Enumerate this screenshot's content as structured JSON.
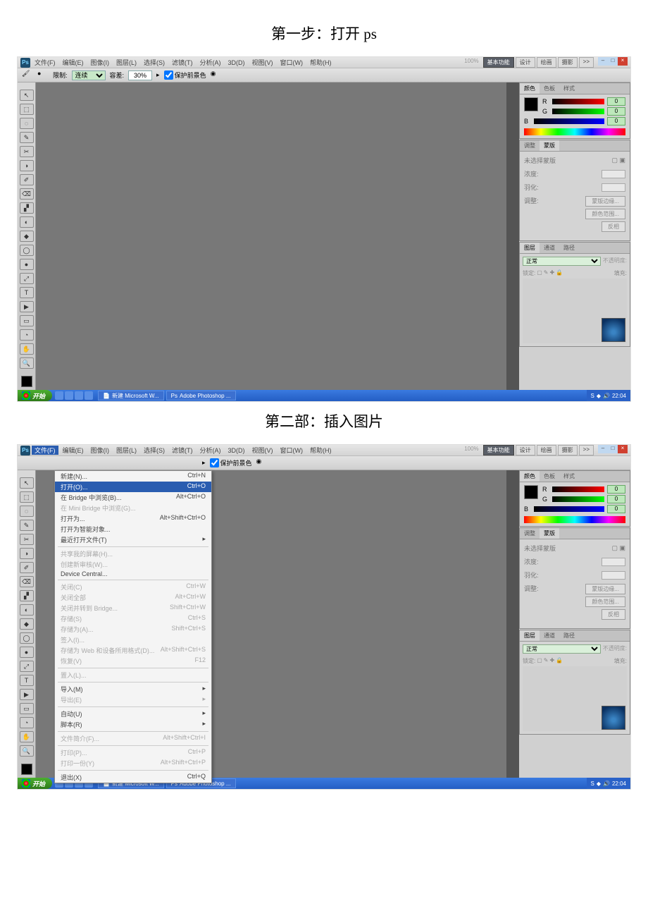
{
  "headings": {
    "step1": "第一步：打开 ps",
    "step2": "第二部：插入图片"
  },
  "menus": [
    "文件(F)",
    "编辑(E)",
    "图像(I)",
    "图层(L)",
    "选择(S)",
    "滤镜(T)",
    "分析(A)",
    "3D(D)",
    "视图(V)",
    "窗口(W)",
    "帮助(H)"
  ],
  "workspaces": {
    "active": "基本功能",
    "others": [
      "设计",
      "绘画",
      "摄影"
    ],
    "expand": ">>"
  },
  "options": {
    "limit_label": "限制:",
    "limit_value": "连续",
    "tolerance_label": "容差:",
    "tolerance_value": "30%",
    "protect": "保护前景色"
  },
  "panels": {
    "color": {
      "tabs": [
        "颜色",
        "色板",
        "样式"
      ],
      "r": "R",
      "g": "G",
      "b": "B",
      "rv": "0",
      "gv": "0",
      "bv": "0"
    },
    "mask": {
      "tabs": [
        "调整",
        "蒙版"
      ],
      "none": "未选择蒙版",
      "density": "浓度:",
      "feather": "羽化:",
      "refine": "调整:",
      "btn_edge": "蒙版边缘...",
      "btn_range": "颜色范围...",
      "btn_invert": "反相"
    },
    "layers": {
      "tabs": [
        "图层",
        "通道",
        "路径"
      ],
      "mode": "正常",
      "opacity_lab": "不透明度:",
      "lock": "锁定:",
      "fill": "填充:"
    }
  },
  "taskbar": {
    "start": "开始",
    "t1": "新建 Microsoft W...",
    "t2": "Adobe Photoshop ...",
    "clock": "22:04"
  },
  "file_menu": [
    {
      "l": "新建(N)...",
      "s": "Ctrl+N"
    },
    {
      "l": "打开(O)...",
      "s": "Ctrl+O",
      "sel": true
    },
    {
      "l": "在 Bridge 中浏览(B)...",
      "s": "Alt+Ctrl+O"
    },
    {
      "l": "在 Mini Bridge 中浏览(G)...",
      "s": "",
      "d": true
    },
    {
      "l": "打开为...",
      "s": "Alt+Shift+Ctrl+O"
    },
    {
      "l": "打开为智能对象..."
    },
    {
      "l": "最近打开文件(T)",
      "arrow": true
    },
    {
      "sep": true
    },
    {
      "l": "共享我的屏幕(H)...",
      "d": true
    },
    {
      "l": "创建新审核(W)...",
      "d": true
    },
    {
      "l": "Device Central..."
    },
    {
      "sep": true
    },
    {
      "l": "关闭(C)",
      "s": "Ctrl+W",
      "d": true
    },
    {
      "l": "关闭全部",
      "s": "Alt+Ctrl+W",
      "d": true
    },
    {
      "l": "关闭并转到 Bridge...",
      "s": "Shift+Ctrl+W",
      "d": true
    },
    {
      "l": "存储(S)",
      "s": "Ctrl+S",
      "d": true
    },
    {
      "l": "存储为(A)...",
      "s": "Shift+Ctrl+S",
      "d": true
    },
    {
      "l": "签入(I)...",
      "d": true
    },
    {
      "l": "存储为 Web 和设备所用格式(D)...",
      "s": "Alt+Shift+Ctrl+S",
      "d": true
    },
    {
      "l": "恢复(V)",
      "s": "F12",
      "d": true
    },
    {
      "sep": true
    },
    {
      "l": "置入(L)...",
      "d": true
    },
    {
      "sep": true
    },
    {
      "l": "导入(M)",
      "arrow": true
    },
    {
      "l": "导出(E)",
      "arrow": true,
      "d": true
    },
    {
      "sep": true
    },
    {
      "l": "自动(U)",
      "arrow": true
    },
    {
      "l": "脚本(R)",
      "arrow": true
    },
    {
      "sep": true
    },
    {
      "l": "文件简介(F)...",
      "s": "Alt+Shift+Ctrl+I",
      "d": true
    },
    {
      "sep": true
    },
    {
      "l": "打印(P)...",
      "s": "Ctrl+P",
      "d": true
    },
    {
      "l": "打印一份(Y)",
      "s": "Alt+Shift+Ctrl+P",
      "d": true
    },
    {
      "sep": true
    },
    {
      "l": "退出(X)",
      "s": "Ctrl+Q"
    }
  ],
  "zoom": "100%",
  "tools": [
    "↖",
    "⬚",
    "◌",
    "✎",
    "✂",
    "◑",
    "✐",
    "⌫",
    "▞",
    "◐",
    "◆",
    "◯",
    "●",
    "⤢",
    "T",
    "▶",
    "▭",
    "◔",
    "✋",
    "🔍"
  ]
}
